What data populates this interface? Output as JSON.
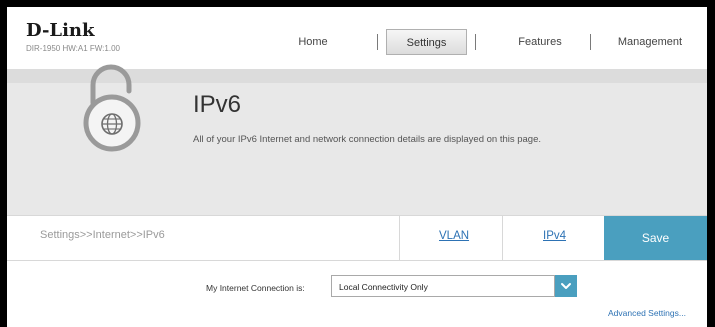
{
  "header": {
    "brand": "D-Link",
    "model_info": "DIR-1950 HW:A1 FW:1.00",
    "nav": [
      {
        "label": "Home"
      },
      {
        "label": "Settings"
      },
      {
        "label": "Features"
      },
      {
        "label": "Management"
      }
    ],
    "active_nav": "Settings"
  },
  "hero": {
    "icon": "open-padlock-globe-icon",
    "title": "IPv6",
    "description": "All of your IPv6 Internet and network connection details are displayed on this page."
  },
  "action_bar": {
    "breadcrumb": "Settings>>Internet>>IPv6",
    "links": [
      {
        "label": "VLAN"
      },
      {
        "label": "IPv4"
      }
    ],
    "save_label": "Save"
  },
  "form": {
    "connection_label": "My Internet Connection is:",
    "connection_value": "Local Connectivity Only",
    "advanced_label": "Advanced Settings..."
  },
  "colors": {
    "accent": "#4a9fbf",
    "link": "#2d72b4",
    "hero_bg": "#e8e8e8"
  }
}
